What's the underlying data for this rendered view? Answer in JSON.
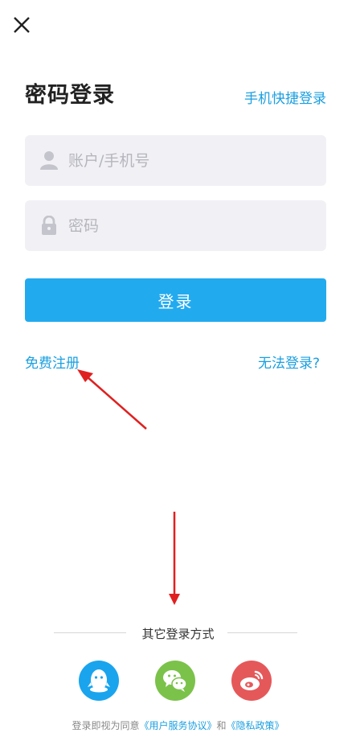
{
  "header": {
    "title": "密码登录",
    "quick_login": "手机快捷登录"
  },
  "icons": {
    "close": "close-icon",
    "user": "user-icon",
    "lock": "lock-icon"
  },
  "form": {
    "account_placeholder": "账户/手机号",
    "password_placeholder": "密码",
    "login_label": "登录"
  },
  "links": {
    "register": "免费注册",
    "cant_login": "无法登录?"
  },
  "other_login": {
    "label": "其它登录方式",
    "providers": [
      {
        "name": "qq",
        "icon": "qq-icon",
        "color": "#1aa4ee"
      },
      {
        "name": "wechat",
        "icon": "wechat-icon",
        "color": "#7bc24a"
      },
      {
        "name": "weibo",
        "icon": "weibo-icon",
        "color": "#e5585a"
      }
    ]
  },
  "terms": {
    "prefix": "登录即视为同意",
    "service": "《用户服务协议》",
    "and": "和",
    "privacy": "《隐私政策》"
  },
  "colors": {
    "accent": "#22aaef",
    "link": "#1a9fe0",
    "annotation": "#e02020"
  }
}
